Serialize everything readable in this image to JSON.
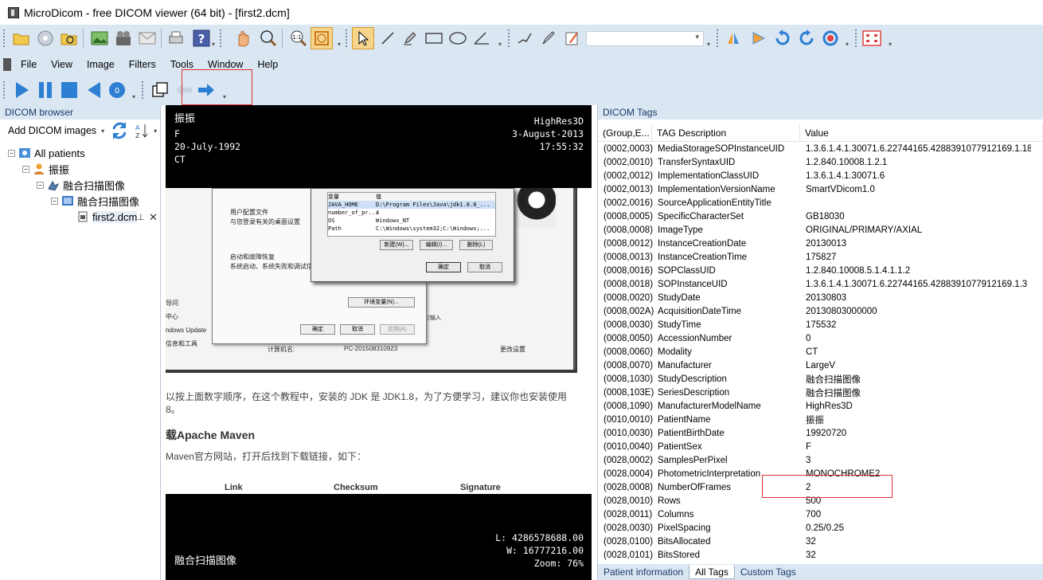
{
  "window": {
    "title": "MicroDicom - free DICOM viewer (64 bit) - [first2.dcm]"
  },
  "menu": [
    "File",
    "View",
    "Image",
    "Filters",
    "Tools",
    "Window",
    "Help"
  ],
  "browser": {
    "title": "DICOM browser",
    "add_label": "Add DICOM images",
    "tree": [
      {
        "label": "All patients",
        "level": 0
      },
      {
        "label": "振振",
        "level": 1
      },
      {
        "label": "融合扫描图像",
        "level": 2
      },
      {
        "label": "融合扫描图像",
        "level": 3
      },
      {
        "label": "first2.dcm",
        "level": 4
      }
    ]
  },
  "viewer": {
    "top_left": [
      "振振",
      "F",
      "20-July-1992",
      "CT"
    ],
    "top_right": [
      "HighRes3D",
      "3-August-2013",
      "17:55:32"
    ],
    "bottom_right": [
      "L: 4286578688.00",
      "W: 16777216.00",
      "Zoom: 76%"
    ],
    "bottom_left": "融合扫描图像",
    "doc_text1": "以按上面数字顺序，在这个教程中，安装的 JDK 是 JDK1.8，为了方便学习，建议你也安装使用",
    "doc_text1b": "8。",
    "doc_heading": "载Apache Maven",
    "doc_text2": "Maven官方网站，打开后找到下载链接，如下：",
    "doc_cols": [
      "Link",
      "Checksum",
      "Signature"
    ],
    "dialog": {
      "env_rows": [
        [
          "JAVA_HOME",
          "D:\\Program Files\\Java\\jdk1.8.0_..."
        ],
        [
          "number_of_pr...",
          "4"
        ],
        [
          "OS",
          "Windows_NT"
        ],
        [
          "Path",
          "C:\\Windows\\system32;C:\\Windows;..."
        ]
      ],
      "env_header": [
        "变量",
        "值"
      ],
      "new_btn": "新建(W)...",
      "edit_btn": "编辑(I)...",
      "delete_btn": "删除(L)",
      "ok": "确定",
      "cancel": "取消",
      "profile_title": "用户配置文件",
      "profile_desc": "与您登录有关的桌面设置",
      "startup_title": "启动和故障恢复",
      "startup_desc": "系统启动、系统失败和调试信息",
      "env_btn": "环境变量(N)...",
      "ok2": "确定",
      "cancel2": "取消",
      "apply2": "应用(A)",
      "left_items": [
        "导问",
        "中心",
        "ndows Update",
        "信息和工具"
      ],
      "computer_name_label": "计算机名:",
      "computer_name": "PC-201508310923",
      "change_settings": "更改设置",
      "input_text": "控输入"
    }
  },
  "tags_panel": {
    "title": "DICOM Tags",
    "headers": [
      "(Group,E...",
      "TAG Description",
      "Value"
    ],
    "rows": [
      [
        "(0002,0003)",
        "MediaStorageSOPInstanceUID",
        "1.3.6.1.4.1.30071.6.22744165.4288391077912169.1.18"
      ],
      [
        "(0002,0010)",
        "TransferSyntaxUID",
        "1.2.840.10008.1.2.1"
      ],
      [
        "(0002,0012)",
        "ImplementationClassUID",
        "1.3.6.1.4.1.30071.6"
      ],
      [
        "(0002,0013)",
        "ImplementationVersionName",
        "SmartVDicom1.0"
      ],
      [
        "(0002,0016)",
        "SourceApplicationEntityTitle",
        ""
      ],
      [
        "(0008,0005)",
        "SpecificCharacterSet",
        "GB18030"
      ],
      [
        "(0008,0008)",
        "ImageType",
        "ORIGINAL/PRIMARY/AXIAL"
      ],
      [
        "(0008,0012)",
        "InstanceCreationDate",
        "20130013"
      ],
      [
        "(0008,0013)",
        "InstanceCreationTime",
        "175827"
      ],
      [
        "(0008,0016)",
        "SOPClassUID",
        "1.2.840.10008.5.1.4.1.1.2"
      ],
      [
        "(0008,0018)",
        "SOPInstanceUID",
        "1.3.6.1.4.1.30071.6.22744165.4288391077912169.1.3"
      ],
      [
        "(0008,0020)",
        "StudyDate",
        "20130803"
      ],
      [
        "(0008,002A)",
        "AcquisitionDateTime",
        "20130803000000"
      ],
      [
        "(0008,0030)",
        "StudyTime",
        "175532"
      ],
      [
        "(0008,0050)",
        "AccessionNumber",
        "0"
      ],
      [
        "(0008,0060)",
        "Modality",
        "CT"
      ],
      [
        "(0008,0070)",
        "Manufacturer",
        "LargeV"
      ],
      [
        "(0008,1030)",
        "StudyDescription",
        "融合扫描图像"
      ],
      [
        "(0008,103E)",
        "SeriesDescription",
        "融合扫描图像"
      ],
      [
        "(0008,1090)",
        "ManufacturerModelName",
        "HighRes3D"
      ],
      [
        "(0010,0010)",
        "PatientName",
        "振振"
      ],
      [
        "(0010,0030)",
        "PatientBirthDate",
        "19920720"
      ],
      [
        "(0010,0040)",
        "PatientSex",
        "F"
      ],
      [
        "(0028,0002)",
        "SamplesPerPixel",
        "3"
      ],
      [
        "(0028,0004)",
        "PhotometricInterpretation",
        "MONOCHROME2"
      ],
      [
        "(0028,0008)",
        "NumberOfFrames",
        "2"
      ],
      [
        "(0028,0010)",
        "Rows",
        "500"
      ],
      [
        "(0028,0011)",
        "Columns",
        "700"
      ],
      [
        "(0028,0030)",
        "PixelSpacing",
        "0.25/0.25"
      ],
      [
        "(0028,0100)",
        "BitsAllocated",
        "32"
      ],
      [
        "(0028,0101)",
        "BitsStored",
        "32"
      ]
    ],
    "tabs": [
      "Patient information",
      "All Tags",
      "Custom Tags"
    ]
  },
  "colors": {
    "toolbar_bg": "#dbe6f3",
    "accent_blue": "#2d7fd3",
    "highlight_red": "#e03030"
  }
}
